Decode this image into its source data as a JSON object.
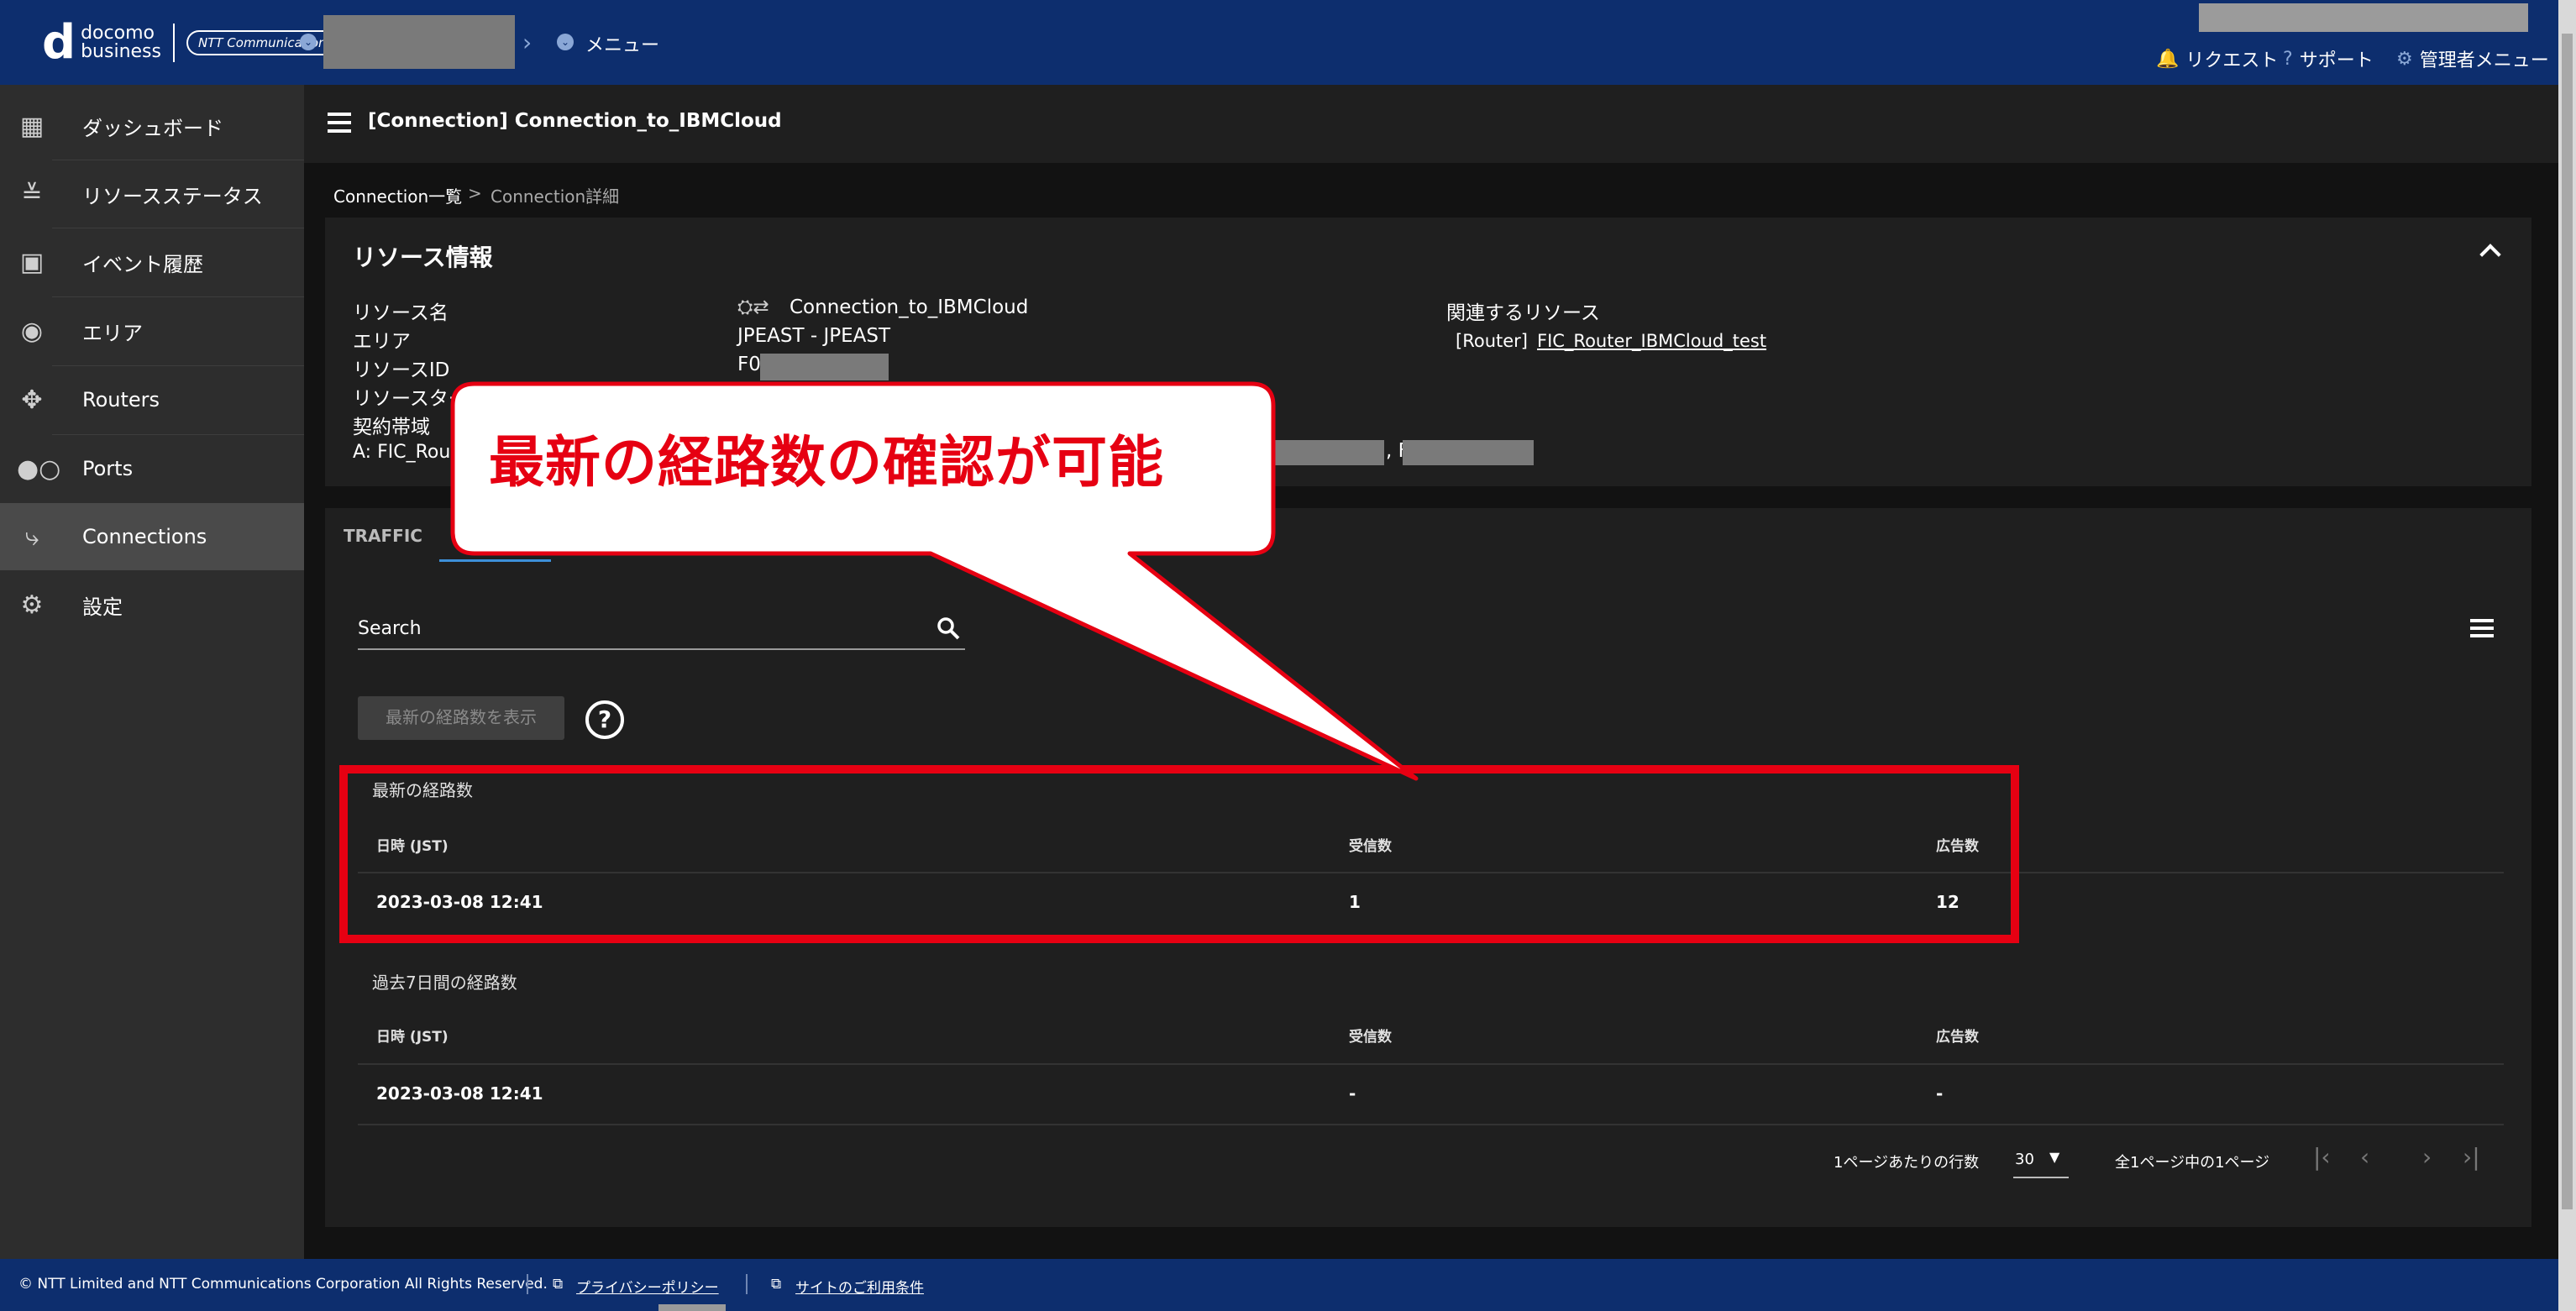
{
  "header": {
    "logo_d": "d",
    "logo_line1": "docomo",
    "logo_line2": "business",
    "logo_ntt": "NTT Communications",
    "menu": "メニュー",
    "request": "リクエスト",
    "support": "サポート",
    "admin_menu": "管理者メニュー"
  },
  "sidebar": {
    "items": [
      {
        "label": "ダッシュボード",
        "icon": "grid-icon"
      },
      {
        "label": "リソースステータス",
        "icon": "status-list-icon"
      },
      {
        "label": "イベント履歴",
        "icon": "calendar-check-icon"
      },
      {
        "label": "エリア",
        "icon": "globe-icon"
      },
      {
        "label": "Routers",
        "icon": "router-icon"
      },
      {
        "label": "Ports",
        "icon": "port-icon"
      },
      {
        "label": "Connections",
        "icon": "connection-icon"
      },
      {
        "label": "設定",
        "icon": "gear-icon"
      }
    ],
    "active_index": 6
  },
  "page": {
    "title": "[Connection] Connection_to_IBMCloud",
    "breadcrumb_parent": "Connection一覧",
    "breadcrumb_sep": ">",
    "breadcrumb_current": "Connection詳細"
  },
  "resource_info": {
    "heading": "リソース情報",
    "labels": {
      "name": "リソース名",
      "area": "エリア",
      "id": "リソースID",
      "status": "リソースター",
      "bandwidth": "契約帯域",
      "a_side": "A: FIC_Rout"
    },
    "values": {
      "name": "Connection_to_IBMCloud",
      "area": "JPEAST - JPEAST",
      "id": "F0",
      "b_sep": ", F"
    },
    "related_heading": "関連するリソース",
    "related_type": "[Router]",
    "related_link": "FIC_Router_IBMCloud_test"
  },
  "tabs": {
    "traffic": "TRAFFIC"
  },
  "search": {
    "placeholder": "Search"
  },
  "actions": {
    "show_latest": "最新の経路数を表示",
    "help": "?"
  },
  "latest_routes": {
    "title": "最新の経路数",
    "columns": [
      "日時 (JST)",
      "受信数",
      "広告数"
    ],
    "rows": [
      [
        "2023-03-08 12:41",
        "1",
        "12"
      ]
    ]
  },
  "past_routes": {
    "title": "過去7日間の経路数",
    "columns": [
      "日時 (JST)",
      "受信数",
      "広告数"
    ],
    "rows": [
      [
        "2023-03-08 12:41",
        "-",
        "-"
      ]
    ]
  },
  "pagination": {
    "rows_per_page_label": "1ページあたりの行数",
    "rows_per_page_value": "30",
    "page_info": "全1ページ中の1ページ"
  },
  "annotation": {
    "callout": "最新の経路数の確認が可能",
    "color": "#e60012"
  },
  "footer": {
    "copyright": "© NTT Limited and NTT Communications Corporation All Rights Reserved.",
    "privacy": "プライバシーポリシー",
    "terms": "サイトのご利用条件"
  }
}
